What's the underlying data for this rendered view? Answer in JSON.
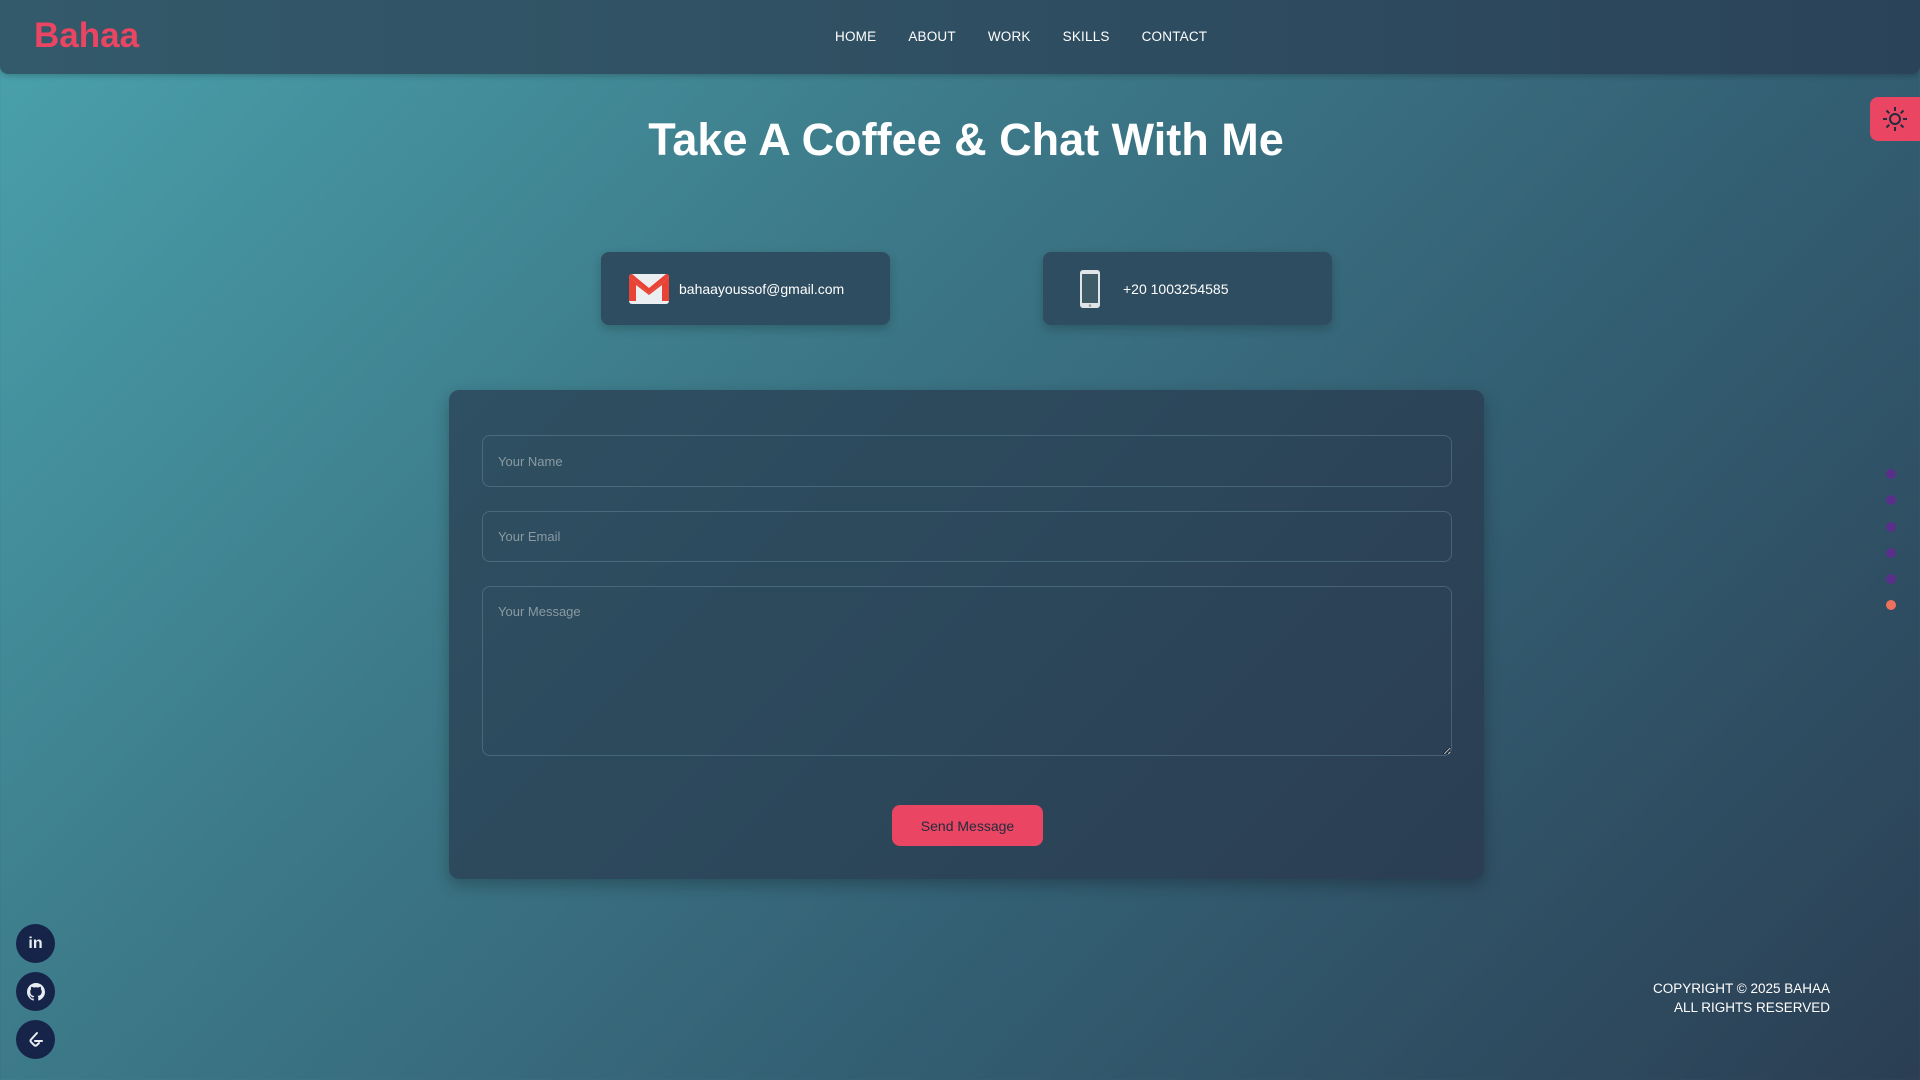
{
  "logo": "Bahaa",
  "nav": {
    "items": [
      "HOME",
      "ABOUT",
      "WORK",
      "SKILLS",
      "CONTACT"
    ]
  },
  "theme_toggle": {
    "icon": "sun-icon"
  },
  "title": "Take A Coffee & Chat With Me",
  "contact_cards": {
    "email": "bahaayoussof@gmail.com",
    "phone": "+20 1003254585"
  },
  "form": {
    "name_placeholder": "Your Name",
    "email_placeholder": "Your Email",
    "message_placeholder": "Your Message",
    "submit": "Send Message"
  },
  "social": [
    {
      "icon": "linkedin-icon",
      "label": "in"
    },
    {
      "icon": "github-icon"
    },
    {
      "icon": "leetcode-icon"
    }
  ],
  "section_dots": {
    "count": 6,
    "active_index": 5
  },
  "footer": {
    "line1": "COPYRIGHT © 2025 BAHAA",
    "line2": "ALL RIGHTS RESERVED"
  },
  "colors": {
    "accent": "#ea4562",
    "dot": "#5a2f8a",
    "dot_active": "#f0705e"
  }
}
